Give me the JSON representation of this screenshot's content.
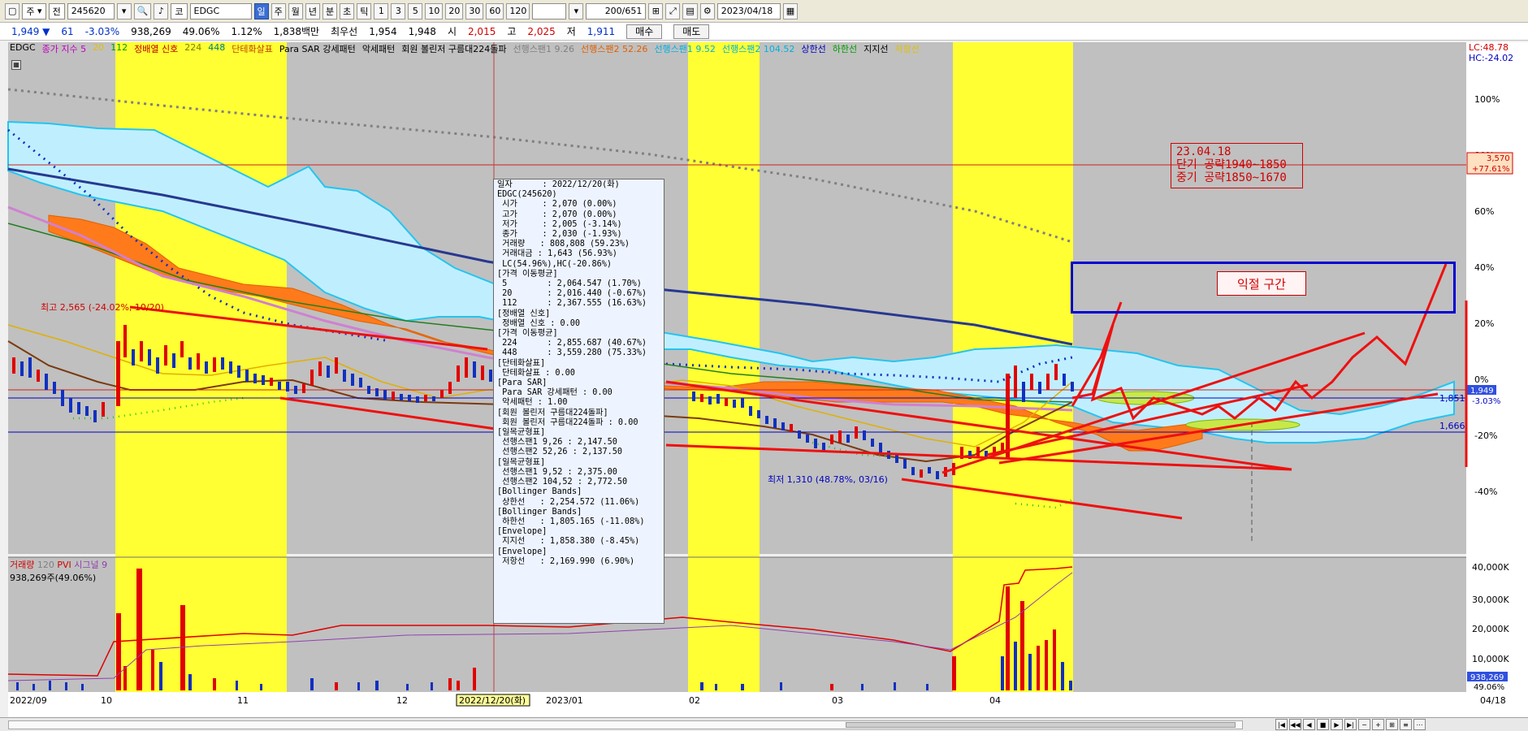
{
  "toolbar": {
    "period_sel": "주",
    "mode_sel": "전",
    "code": "245620",
    "name_code": "코",
    "name": "EDGC",
    "tabs": [
      "일",
      "주",
      "월",
      "년",
      "분",
      "초",
      "틱"
    ],
    "intervals": [
      "1",
      "3",
      "5",
      "10",
      "20",
      "30",
      "60",
      "120"
    ],
    "count": "200/651",
    "date": "2023/04/18"
  },
  "quote": {
    "price": "1,949",
    "change": "61",
    "change_pct": "-3.03%",
    "volume": "938,269",
    "vol_pct": "49.06%",
    "turnover": "1.12%",
    "amount": "1,838백만",
    "prev_label": "최우선",
    "prev1": "1,954",
    "prev2": "1,948",
    "open_label": "시",
    "open": "2,015",
    "high_label": "고",
    "high": "2,025",
    "low_label": "저",
    "low": "1,911",
    "buy": "매수",
    "sell": "매도"
  },
  "legend": [
    {
      "text": "EDGC",
      "color": "#000000"
    },
    {
      "text": "종가 지수 5",
      "color": "#c000c0"
    },
    {
      "text": "20",
      "color": "#e0c000"
    },
    {
      "text": "112",
      "color": "#00a000"
    },
    {
      "text": "정배열 신호",
      "color": "#c00000"
    },
    {
      "text": "224",
      "color": "#808000"
    },
    {
      "text": "448",
      "color": "#008080"
    },
    {
      "text": "단테화살표",
      "color": "#c04000"
    },
    {
      "text": "Para SAR 강세패턴",
      "color": "#000000"
    },
    {
      "text": "악세패턴",
      "color": "#000000"
    },
    {
      "text": "회원 볼린저 구름대224돌파",
      "color": "#000000"
    },
    {
      "text": "선행스팬1 9.26",
      "color": "#808080"
    },
    {
      "text": "선행스팬2 52.26",
      "color": "#e06000"
    },
    {
      "text": "선행스팬1 9.52",
      "color": "#00b0e0"
    },
    {
      "text": "선행스팬2 104.52",
      "color": "#00b0e0"
    },
    {
      "text": "상한선",
      "color": "#0000c0"
    },
    {
      "text": "하한선",
      "color": "#00a000"
    },
    {
      "text": "지지선",
      "color": "#000000"
    },
    {
      "text": "저항선",
      "color": "#e0c000"
    }
  ],
  "right_labels": {
    "lc": "LC:48.78",
    "hc": "HC:-24.02",
    "mark_price": "3,570",
    "mark_pct": "+77.61%",
    "current": "1,949",
    "current_pct": "-3.03%",
    "level1": "1,851",
    "level2": "1,666",
    "vol_current": "938,269",
    "vol_pct": "49.06%"
  },
  "y_ticks": [
    "100%",
    "80%",
    "60%",
    "40%",
    "20%",
    "0%",
    "-20%",
    "-40%"
  ],
  "vol_ticks": [
    "40,000K",
    "30,000K",
    "20,000K",
    "10,000K"
  ],
  "x_ticks": [
    "2022/09",
    "10",
    "11",
    "12",
    "2022/12/20(화)",
    "2023/01",
    "02",
    "03",
    "04",
    "04/18"
  ],
  "volume_legend": {
    "title": "거래량",
    "period": "120",
    "pvi": "PVI",
    "signal": "시그널 9",
    "value": "938,269주(49.06%)"
  },
  "annotations": {
    "high_label": "최고 2,565 (-24.02%, 10/20)",
    "low_label": "최저 1,310 (48.78%, 03/16)",
    "note_lines": [
      "23.04.18",
      "단기 공략1940~1850",
      "중기 공략1850~1670"
    ],
    "zone_label": "익절 구간"
  },
  "tooltip_lines": [
    "일자      : 2022/12/20(화)",
    "EDGC(245620)",
    " 시가     : 2,070 (0.00%)",
    " 고가     : 2,070 (0.00%)",
    " 저가     : 2,005 (-3.14%)",
    " 종가     : 2,030 (-1.93%)",
    " 거래량   : 808,808 (59.23%)",
    " 거래대금 : 1,643 (56.93%)",
    " LC(54.96%),HC(-20.86%)",
    "[가격 이동평균]",
    " 5        : 2,064.547 (1.70%)",
    " 20       : 2,016.440 (-0.67%)",
    " 112      : 2,367.555 (16.63%)",
    "[정배열 신호]",
    " 정배열 신호 : 0.00",
    "[가격 이동평균]",
    " 224      : 2,855.687 (40.67%)",
    " 448      : 3,559.280 (75.33%)",
    "[단테화살표]",
    " 단테화살표 : 0.00",
    "[Para SAR]",
    " Para SAR 강세패턴 : 0.00",
    " 악세패턴 : 1.00",
    "[회원 볼린저 구름대224돌파]",
    " 회원 볼린저 구름대224돌파 : 0.00",
    "[일목균형표]",
    " 선행스팬1 9,26 : 2,147.50",
    " 선행스팬2 52,26 : 2,137.50",
    "[일목균형표]",
    " 선행스팬1 9,52 : 2,375.00",
    " 선행스팬2 104,52 : 2,772.50",
    "[Bollinger Bands]",
    " 상한선   : 2,254.572 (11.06%)",
    "[Bollinger Bands]",
    " 하한선   : 1,805.165 (-11.08%)",
    "[Envelope]",
    " 지지선   : 1,858.380 (-8.45%)",
    "[Envelope]",
    " 저항선   : 2,169.990 (6.90%)"
  ]
}
